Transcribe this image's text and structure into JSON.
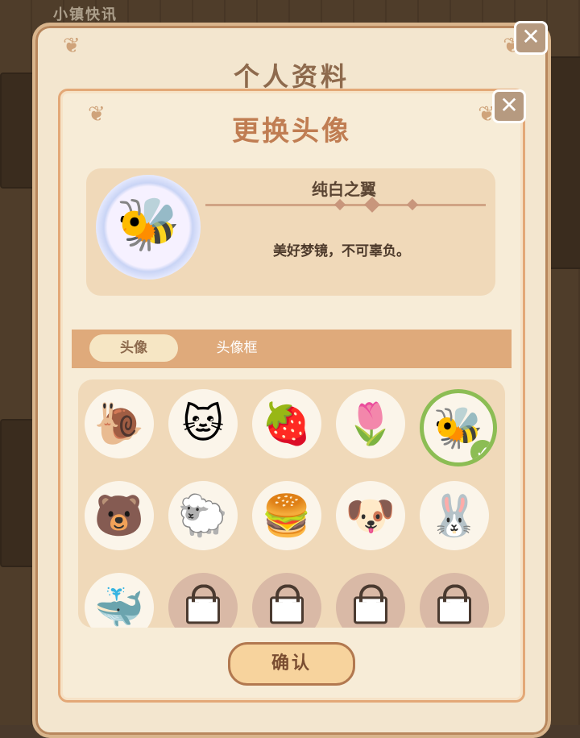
{
  "background": {
    "title": "小镇快讯"
  },
  "outer_panel": {
    "title": "个人资料",
    "close_icon": "close-icon"
  },
  "modal": {
    "title": "更换头像",
    "close_icon": "close-icon",
    "preview": {
      "frame_name": "纯白之翼",
      "frame_description": "美好梦镜，不可辜负。",
      "avatar": "bee"
    },
    "tabs": [
      {
        "label": "头像",
        "active": true
      },
      {
        "label": "头像框",
        "active": false
      }
    ],
    "avatars": [
      {
        "name": "snail",
        "icon": "🐌",
        "locked": false,
        "selected": false
      },
      {
        "name": "gray-cat",
        "icon": "🐱",
        "locked": false,
        "selected": false
      },
      {
        "name": "strawberry",
        "icon": "🍓",
        "locked": false,
        "selected": false
      },
      {
        "name": "tulip",
        "icon": "🌷",
        "locked": false,
        "selected": false
      },
      {
        "name": "bee",
        "icon": "🐝",
        "locked": false,
        "selected": true
      },
      {
        "name": "bear",
        "icon": "🐻",
        "locked": false,
        "selected": false
      },
      {
        "name": "sheep",
        "icon": "🐑",
        "locked": false,
        "selected": false
      },
      {
        "name": "burger",
        "icon": "🍔",
        "locked": false,
        "selected": false
      },
      {
        "name": "dog",
        "icon": "🐶",
        "locked": false,
        "selected": false
      },
      {
        "name": "bunny",
        "icon": "🐰",
        "locked": false,
        "selected": false
      },
      {
        "name": "whale",
        "icon": "🐳",
        "locked": false,
        "selected": false
      },
      {
        "name": "locked-1",
        "icon": "lock",
        "locked": true,
        "selected": false
      },
      {
        "name": "locked-2",
        "icon": "lock",
        "locked": true,
        "selected": false
      },
      {
        "name": "locked-3",
        "icon": "lock",
        "locked": true,
        "selected": false
      },
      {
        "name": "locked-4",
        "icon": "lock",
        "locked": true,
        "selected": false
      }
    ],
    "confirm_label": "确认"
  },
  "colors": {
    "accent": "#c07d52",
    "selected": "#8cbd54",
    "panel": "#f3e6cf"
  }
}
